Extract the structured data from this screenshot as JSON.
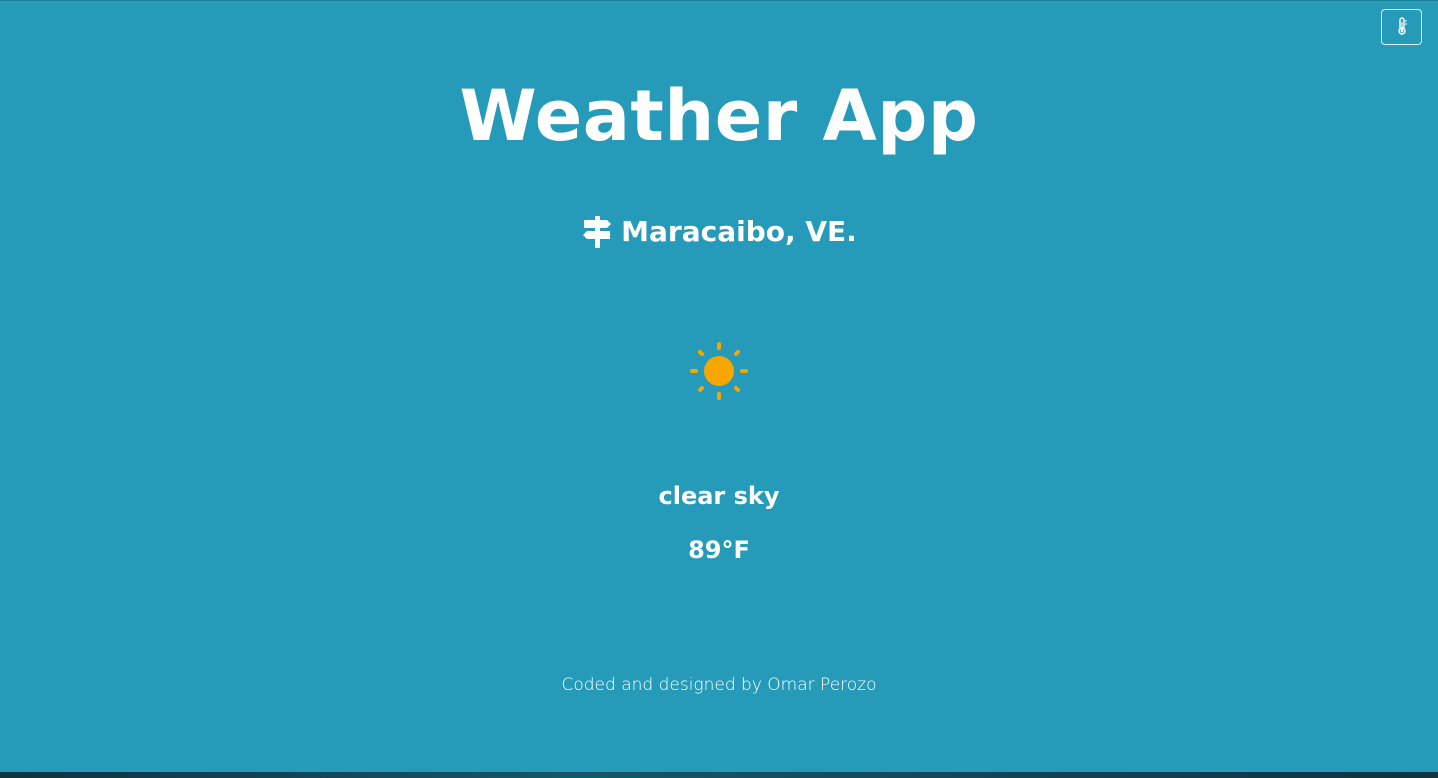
{
  "app": {
    "title": "Weather App"
  },
  "toolbar": {
    "unit_toggle_icon": "thermometer-icon"
  },
  "location": {
    "icon": "signpost-icon",
    "label": "Maracaibo, VE."
  },
  "weather": {
    "icon": "sun-icon",
    "description": "clear sky",
    "temperature": "89°F"
  },
  "footer": {
    "credit": "Coded and designed by Omar Perozo"
  },
  "colors": {
    "background": "#259bb9",
    "text": "#ffffff",
    "sun": "#f7a600"
  }
}
